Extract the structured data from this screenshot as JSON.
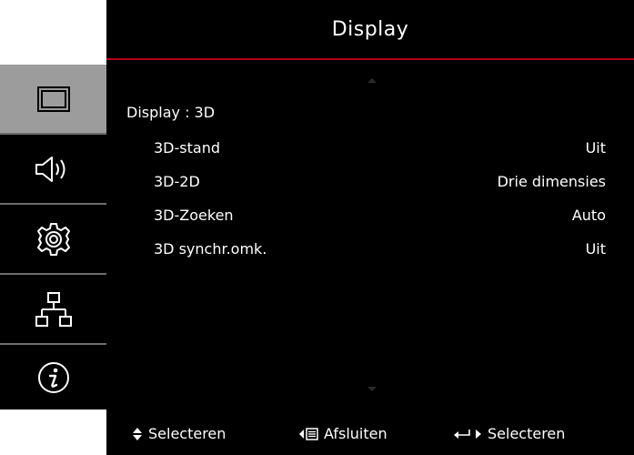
{
  "header": {
    "title": "Display"
  },
  "sidebar": {
    "items": [
      {
        "icon": "display-icon",
        "active": true
      },
      {
        "icon": "speaker-icon",
        "active": false
      },
      {
        "icon": "gear-icon",
        "active": false
      },
      {
        "icon": "network-icon",
        "active": false
      },
      {
        "icon": "info-icon",
        "active": false
      }
    ]
  },
  "main": {
    "section_title": "Display : 3D",
    "rows": [
      {
        "label": "3D-stand",
        "value": "Uit"
      },
      {
        "label": "3D-2D",
        "value": "Drie dimensies"
      },
      {
        "label": "3D-Zoeken",
        "value": "Auto"
      },
      {
        "label": "3D synchr.omk.",
        "value": "Uit"
      }
    ]
  },
  "footer": {
    "select_label": "Selecteren",
    "exit_label": "Afsluiten",
    "enter_label": "Selecteren"
  },
  "colors": {
    "accent_line": "#b4001c",
    "sidebar_active": "#9c9c9c",
    "background": "#000000"
  }
}
